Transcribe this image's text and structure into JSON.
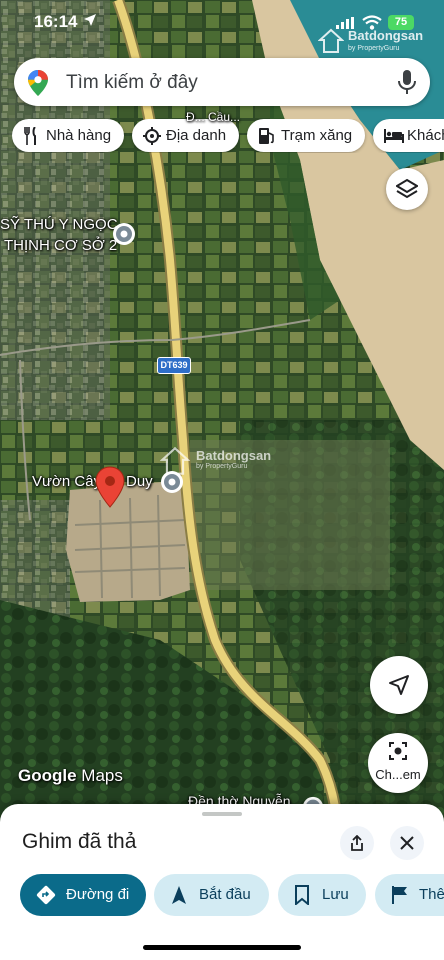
{
  "status_bar": {
    "time": "16:14",
    "battery": "75"
  },
  "watermark": {
    "name": "Batdongsan",
    "sub": "by PropertyGuru"
  },
  "search": {
    "placeholder": "Tìm kiếm ở đây",
    "value": ""
  },
  "chips": [
    {
      "label": "Nhà hàng",
      "icon": "fork-knife-icon"
    },
    {
      "label": "Địa danh",
      "icon": "landmark-icon"
    },
    {
      "label": "Trạm xăng",
      "icon": "gas-station-icon"
    },
    {
      "label": "Khách",
      "icon": "bed-icon"
    }
  ],
  "map": {
    "labels": {
      "poi_1_line1": "SỸ THÚ Y NGỌC",
      "poi_1_line2": "THỊNH CƠ SỞ 2",
      "poi_2_left": "Vườn Cây",
      "poi_2_right": "Duy",
      "poi_3": "Đền thờ Nguyễn",
      "top_label": "Đ... Cầu..."
    },
    "road_badge": "DT639",
    "google_logo_a": "Google",
    "google_logo_b": "Maps"
  },
  "street_view_button": "Ch...em",
  "sheet": {
    "title": "Ghim đã thả",
    "actions": [
      {
        "label": "Đường đi",
        "icon": "directions-icon"
      },
      {
        "label": "Bắt đầu",
        "icon": "navigation-icon"
      },
      {
        "label": "Lưu",
        "icon": "bookmark-icon"
      },
      {
        "label": "Thê",
        "icon": "flag-icon"
      }
    ]
  },
  "colors": {
    "primary_action": "#0b6b8a",
    "action_bg": "#d3ebf3",
    "pin_red": "#ea4335",
    "sea": "#2a8c95",
    "sand": "#d9c6a0",
    "road": "#e8d27a"
  }
}
